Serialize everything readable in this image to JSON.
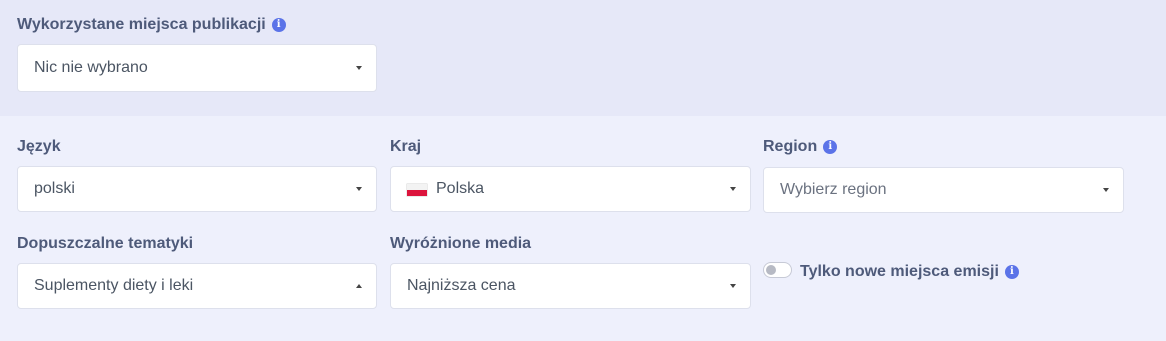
{
  "publication_places": {
    "label": "Wykorzystane miejsca publikacji",
    "value": "Nic nie wybrano"
  },
  "language": {
    "label": "Język",
    "value": "polski"
  },
  "country": {
    "label": "Kraj",
    "value": "Polska",
    "flag": "poland-flag-icon"
  },
  "region": {
    "label": "Region",
    "placeholder": "Wybierz region"
  },
  "topics": {
    "label": "Dopuszczalne tematyki",
    "value": "Suplementy diety i leki",
    "open": true
  },
  "featured_media": {
    "label": "Wyróżnione media",
    "value": "Najniższa cena"
  },
  "new_only": {
    "label": "Tylko nowe miejsca emisji",
    "checked": false
  },
  "colors": {
    "accent": "#5b73e8",
    "label_text": "#4e5a7a",
    "top_band": "#e6e8f8",
    "bottom_band": "#eef0fc"
  },
  "icons": {
    "info": "info-icon",
    "dropdown": "caret-down-icon"
  }
}
